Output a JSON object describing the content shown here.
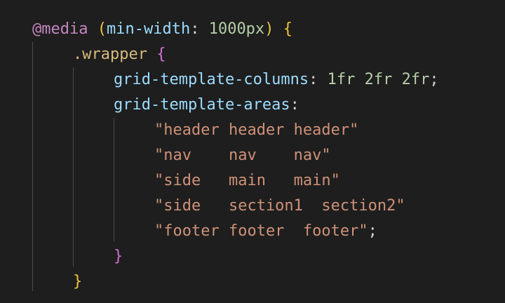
{
  "code": {
    "l1": {
      "at": "@media",
      "open_paren": "(",
      "prop": "min-width",
      "colon": ":",
      "value": "1000px",
      "close_paren": ")",
      "brace": "{"
    },
    "l2": {
      "selector": ".wrapper",
      "brace": "{"
    },
    "l3": {
      "prop": "grid-template-columns",
      "colon": ":",
      "value": "1fr 2fr 2fr",
      "semi": ";"
    },
    "l4": {
      "prop": "grid-template-areas",
      "colon": ":"
    },
    "l5": {
      "str": "\"header header header\""
    },
    "l6": {
      "str": "\"nav    nav    nav\""
    },
    "l7": {
      "str": "\"side   main   main\""
    },
    "l8": {
      "str": "\"side   section1  section2\""
    },
    "l9": {
      "str": "\"footer footer  footer\"",
      "semi": ";"
    },
    "l10": {
      "brace": "}"
    },
    "l11": {
      "brace": "}"
    }
  },
  "colors": {
    "background": "#1e1e1e",
    "at_rule": "#c586c0",
    "property": "#9cdcfe",
    "selector": "#d7ba7d",
    "number": "#b5cea8",
    "string": "#ce9178",
    "brace_outer": "#f0c23b",
    "brace_inner": "#d16fd0"
  }
}
